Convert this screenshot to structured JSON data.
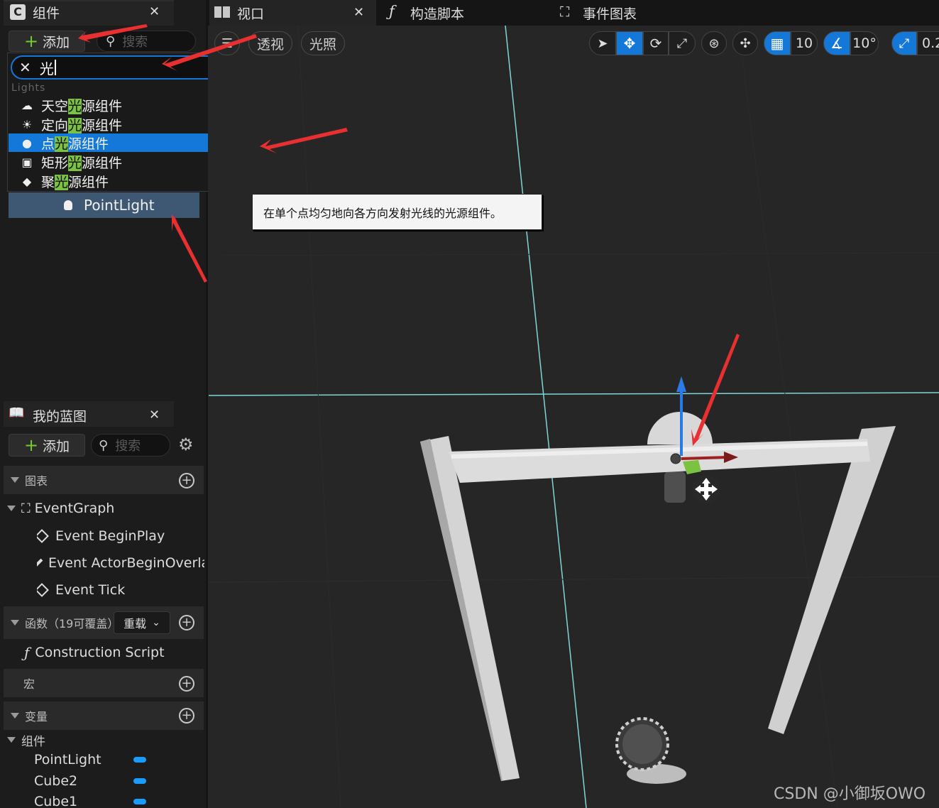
{
  "components_panel": {
    "tab_title": "组件",
    "add_label": "添加",
    "search_placeholder": "搜索",
    "search_value": "光",
    "category": "Lights",
    "items": [
      {
        "pre": "天空",
        "hl": "光",
        "post": "源组件",
        "icon": "sky-light-icon"
      },
      {
        "pre": "定向",
        "hl": "光",
        "post": "源组件",
        "icon": "directional-light-icon"
      },
      {
        "pre": "点",
        "hl": "光",
        "post": "源组件",
        "icon": "point-light-icon"
      },
      {
        "pre": "矩形",
        "hl": "光",
        "post": "源组件",
        "icon": "rect-light-icon"
      },
      {
        "pre": "聚",
        "hl": "光",
        "post": "源组件",
        "icon": "spot-light-icon"
      }
    ],
    "tree_item": "PointLight"
  },
  "tooltip": "在单个点均匀地向各方向发射光线的光源组件。",
  "tabs": {
    "viewport": "视口",
    "construction": "构造脚本",
    "event_graph": "事件图表"
  },
  "viewport_toolbar": {
    "perspective": "透视",
    "lighting": "光照",
    "grid_snap": "10",
    "rotate_snap": "10°",
    "scale_snap": "0.2"
  },
  "blueprint_panel": {
    "tab_title": "我的蓝图",
    "add_label": "添加",
    "search_placeholder": "搜索",
    "graphs_label": "图表",
    "event_graph": "EventGraph",
    "events": [
      "Event BeginPlay",
      "Event ActorBeginOverla",
      "Event Tick"
    ],
    "functions_label": "函数（19可覆盖）",
    "override_label": "重载",
    "construction_script": "Construction Script",
    "macros_label": "宏",
    "variables_label": "变量",
    "components_label": "组件",
    "component_vars": [
      "PointLight",
      "Cube2",
      "Cube1"
    ]
  },
  "watermark": "CSDN @小御坂OWO",
  "colors": {
    "accent": "#1478d8",
    "highlight": "#7cc242",
    "arrow": "#e83030"
  }
}
